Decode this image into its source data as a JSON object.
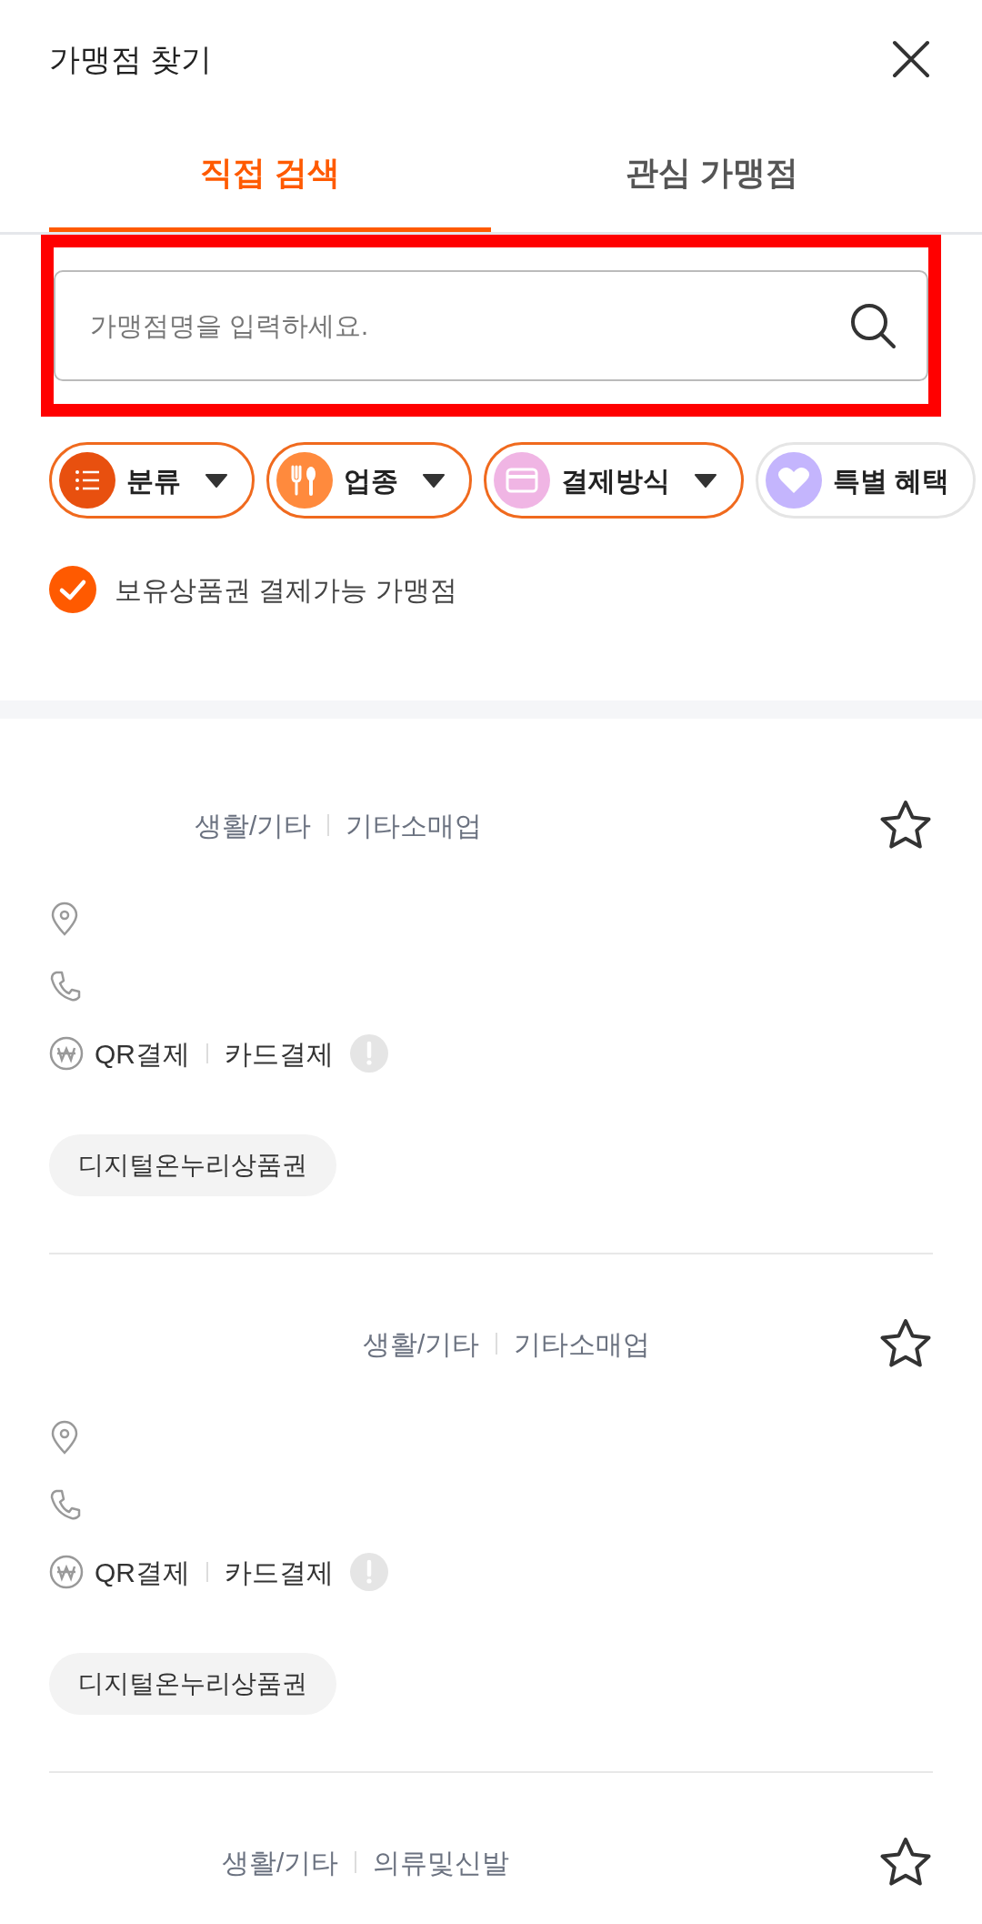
{
  "header": {
    "title": "가맹점 찾기"
  },
  "tabs": [
    {
      "label": "직접 검색",
      "selected": true
    },
    {
      "label": "관심 가맹점",
      "selected": false
    }
  ],
  "search": {
    "placeholder": "가맹점명을 입력하세요.",
    "highlighted": true
  },
  "filters": [
    {
      "label": "분류",
      "kind": "list",
      "color": "#e8500f",
      "selected": true,
      "dropdown": true
    },
    {
      "label": "업종",
      "kind": "utensils",
      "color": "#ff8a3d",
      "selected": true,
      "dropdown": true
    },
    {
      "label": "결제방식",
      "kind": "card",
      "color": "#f0b5e4",
      "selected": true,
      "dropdown": true
    },
    {
      "label": "특별 혜택",
      "kind": "heart",
      "color": "#c4b5fd",
      "selected": false,
      "dropdown": false
    }
  ],
  "voucher_filter": {
    "label": "보유상품권 결제가능 가맹점",
    "checked": true
  },
  "stores": [
    {
      "category": "생활/기타",
      "subcategory": "기타소매업",
      "favorite": false,
      "payments": [
        "QR결제",
        "카드결제"
      ],
      "tags": [
        "디지털온누리상품권"
      ]
    },
    {
      "category": "생활/기타",
      "subcategory": "기타소매업",
      "favorite": false,
      "payments": [
        "QR결제",
        "카드결제"
      ],
      "tags": [
        "디지털온누리상품권"
      ]
    },
    {
      "category": "생활/기타",
      "subcategory": "의류및신발",
      "favorite": false
    }
  ]
}
